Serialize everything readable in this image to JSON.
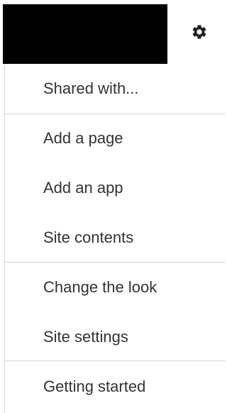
{
  "header": {
    "gear_icon": "gear-icon"
  },
  "menu": {
    "items": [
      {
        "label": "Shared with..."
      },
      {
        "label": "Add a page"
      },
      {
        "label": "Add an app"
      },
      {
        "label": "Site contents"
      },
      {
        "label": "Change the look"
      },
      {
        "label": "Site settings"
      },
      {
        "label": "Getting started"
      }
    ]
  }
}
